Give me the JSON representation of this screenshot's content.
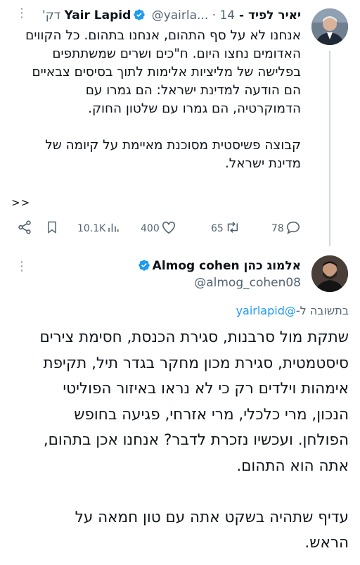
{
  "tweet_main": {
    "display_name": "יאיר לפיד - Yair Lapid",
    "handle": "@yairla...",
    "time": "14 דק'",
    "text": "אנחנו לא על סף התהום, אנחנו בתהום. כל הקווים\nהאדומים נחצו היום. ח\"כים ושרים שמשתתפים\nבפלישה של מליציות אלימות לתוך בסיסים צבאיים\nהם הודעה למדינת ישראל: הם גמרו עם\nהדמוקרטיה, הם גמרו עם שלטון החוק.\n\nקבוצה פשיסטית מסוכנת מאיימת על קיומה של\nמדינת ישראל.",
    "show_more": ">>",
    "stats": {
      "views": "10.1K",
      "likes": "400",
      "retweets": "65",
      "replies": "78"
    }
  },
  "tweet_reply": {
    "display_name": "אלמוג כהן Almog cohen",
    "handle": "@almog_cohen08",
    "replying_prefix": "בתשובה ל-",
    "replying_to": "@yairlapid",
    "text": "שתקת מול סרבנות, סגירת הכנסת, חסימת צירים\nסיסטמטית, סגירת מכון מחקר בגדר תיל, תקיפת\nאימהות וילדים רק כי לא נראו באיזור הפוליטי\nהנכון, מרי כלכלי, מרי אזרחי, פגיעה בחופש\nהפולחן. ועכשיו נזכרת לדבר? אנחנו אכן בתהום,\nאתה הוא התהום.\n\nעדיף שתהיה בשקט אתה עם טון חמאה על\nהראש."
  },
  "colors": {
    "verified": "#1d9bf0",
    "link": "#1d9bf0",
    "muted": "#536471",
    "text": "#0f1419"
  }
}
